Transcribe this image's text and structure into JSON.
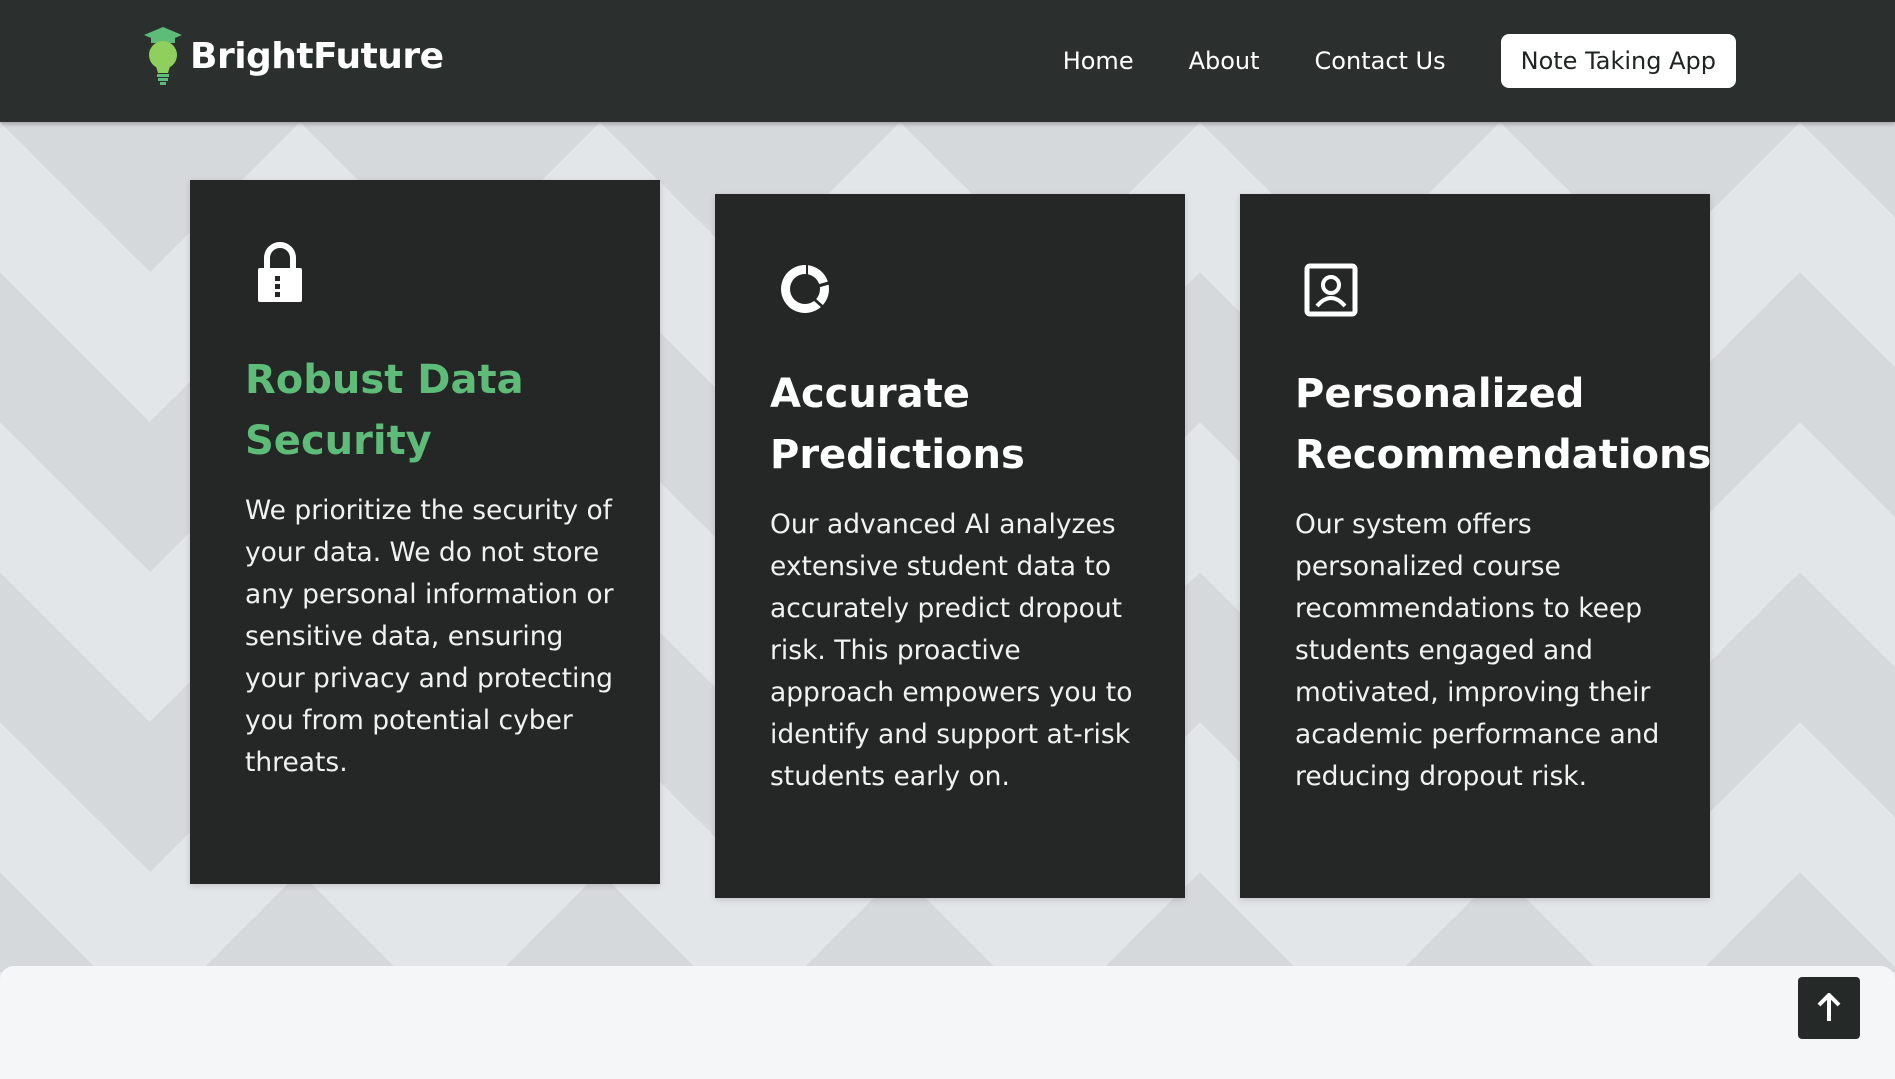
{
  "header": {
    "brand": "BrightFuture",
    "logo_icon": "lightbulb-graduation-cap-icon",
    "nav": [
      {
        "label": "Home"
      },
      {
        "label": "About"
      },
      {
        "label": "Contact Us"
      }
    ],
    "cta_label": "Note Taking App"
  },
  "features": [
    {
      "icon": "lock-icon",
      "title": "Robust Data Security",
      "body": "We prioritize the security of your data. We do not store any personal information or sensitive data, ensuring your privacy and protecting you from potential cyber threats."
    },
    {
      "icon": "donut-chart-icon",
      "title": "Accurate Predictions",
      "body": "Our advanced AI analyzes extensive student data to accurately predict dropout risk. This proactive approach empowers you to identify and support at-risk students early on."
    },
    {
      "icon": "user-profile-icon",
      "title": "Personalized Recommendations",
      "body": "Our system offers personalized course recommendations to keep students engaged and motivated, improving their academic performance and reducing dropout risk."
    }
  ],
  "scroll_top_icon": "arrow-up-icon",
  "colors": {
    "header_bg": "#2b302f",
    "card_bg": "#252626",
    "accent_green": "#5dbc78"
  }
}
